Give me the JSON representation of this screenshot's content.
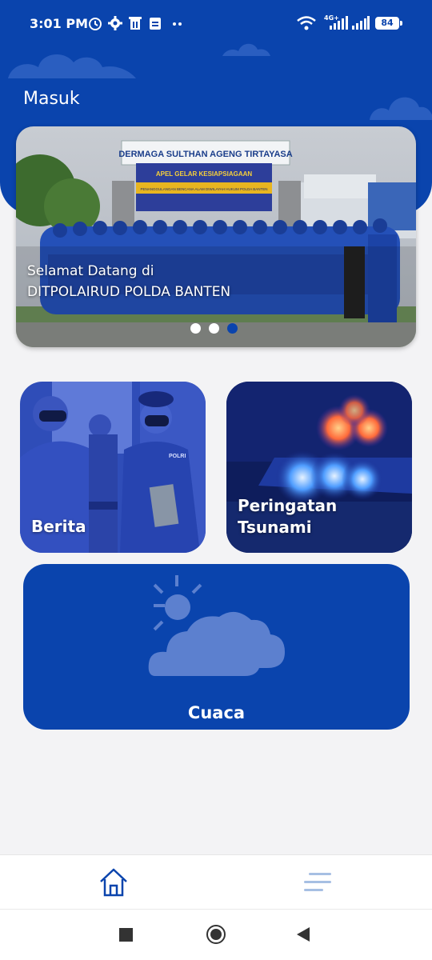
{
  "status_bar": {
    "time": "3:01 PM",
    "network": "4G+",
    "battery": "84"
  },
  "header": {
    "title": "Masuk"
  },
  "banner": {
    "caption_line1": "Selamat Datang di",
    "caption_line2": "DITPOLAIRUD POLDA BANTEN",
    "photo_sign_text": "DERMAGA SULTHAN AGENG TIRTAYASA",
    "photo_banner_text": "APEL GELAR KESIAPSIAGAAN",
    "photo_banner_subtext": "PENANGGULANGAN BENCANA ALAM DIWILAYAH HUKUM POLDA BANTEN",
    "dots": 3,
    "active_dot": 2
  },
  "tiles": {
    "berita": {
      "label": "Berita",
      "photo_text": "POLRI"
    },
    "tsunami": {
      "label_line1": "Peringatan",
      "label_line2": "Tsunami"
    },
    "cuaca": {
      "label": "Cuaca",
      "icon": "partly-cloudy-icon"
    }
  },
  "bottom_nav": [
    {
      "icon": "home-icon",
      "active": true
    },
    {
      "icon": "menu-icon",
      "active": false
    }
  ],
  "system_nav": [
    "recent-apps-icon",
    "home-circle-icon",
    "back-icon"
  ],
  "colors": {
    "primary": "#0a44ad",
    "background": "#f3f3f5",
    "cloud": "#2a5ec0",
    "inactive_nav": "#a6bfe3"
  }
}
